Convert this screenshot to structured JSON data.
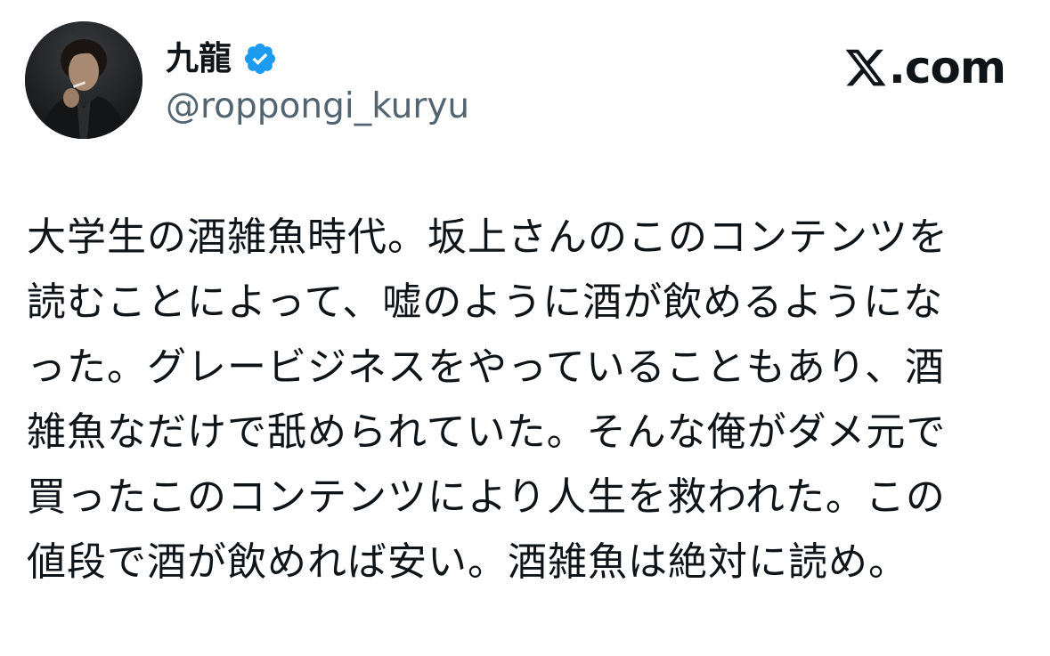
{
  "author": {
    "display_name": "九龍",
    "handle": "@roppongi_kuryu",
    "verified": true,
    "avatar_icon": "profile-photo"
  },
  "brand": {
    "logo_icon": "x-logo-icon",
    "domain_text": ".com"
  },
  "tweet": {
    "lines": [
      "大学生の酒雑魚時代。坂上さんのこのコンテンツを",
      "読むことによって、嘘のように酒が飲めるようにな",
      "った。グレービジネスをやっていることもあり、酒",
      "雑魚なだけで舐められていた。そんな俺がダメ元で",
      "買ったこのコンテンツにより人生を救われた。この",
      "値段で酒が飲めれば安い。酒雑魚は絶対に読め。"
    ]
  },
  "colors": {
    "text_primary": "#0f1419",
    "text_secondary": "#536471",
    "verified_blue": "#1d9bf0",
    "background": "#ffffff"
  }
}
